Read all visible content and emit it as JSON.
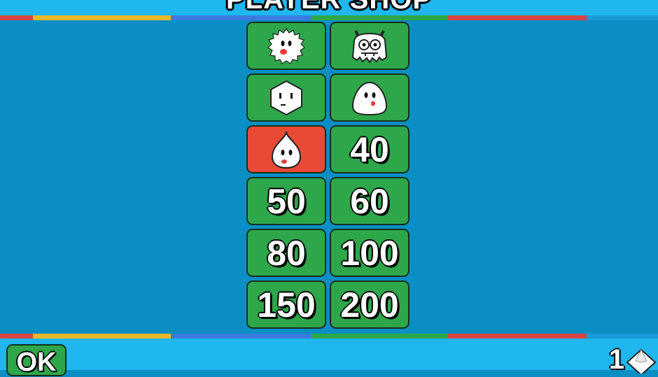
{
  "header": {
    "title": "PLAYER SHOP"
  },
  "colors": {
    "background": "#0a8ec4",
    "bar": "#1fb7ee",
    "tile_green": "#2ea64a",
    "tile_selected": "#e84a36",
    "stripe": [
      "#d94545",
      "#e8b82a",
      "#3a7be0",
      "#1a9ad6",
      "#2ea64a",
      "#d94545"
    ]
  },
  "shop": {
    "tiles": [
      {
        "icon": "fuzzy-ball-character-icon",
        "owned": true
      },
      {
        "icon": "monster-character-icon",
        "owned": true
      },
      {
        "icon": "hexagon-character-icon",
        "owned": true
      },
      {
        "icon": "egg-character-icon",
        "owned": true
      },
      {
        "icon": "droplet-character-icon",
        "owned": true,
        "selected": true
      },
      {
        "price": "40"
      },
      {
        "price": "50"
      },
      {
        "price": "60"
      },
      {
        "price": "80"
      },
      {
        "price": "100"
      },
      {
        "price": "150"
      },
      {
        "price": "200"
      }
    ]
  },
  "footer": {
    "ok_label": "OK",
    "gem_count": "1",
    "gem_icon": "diamond-gem-icon"
  }
}
